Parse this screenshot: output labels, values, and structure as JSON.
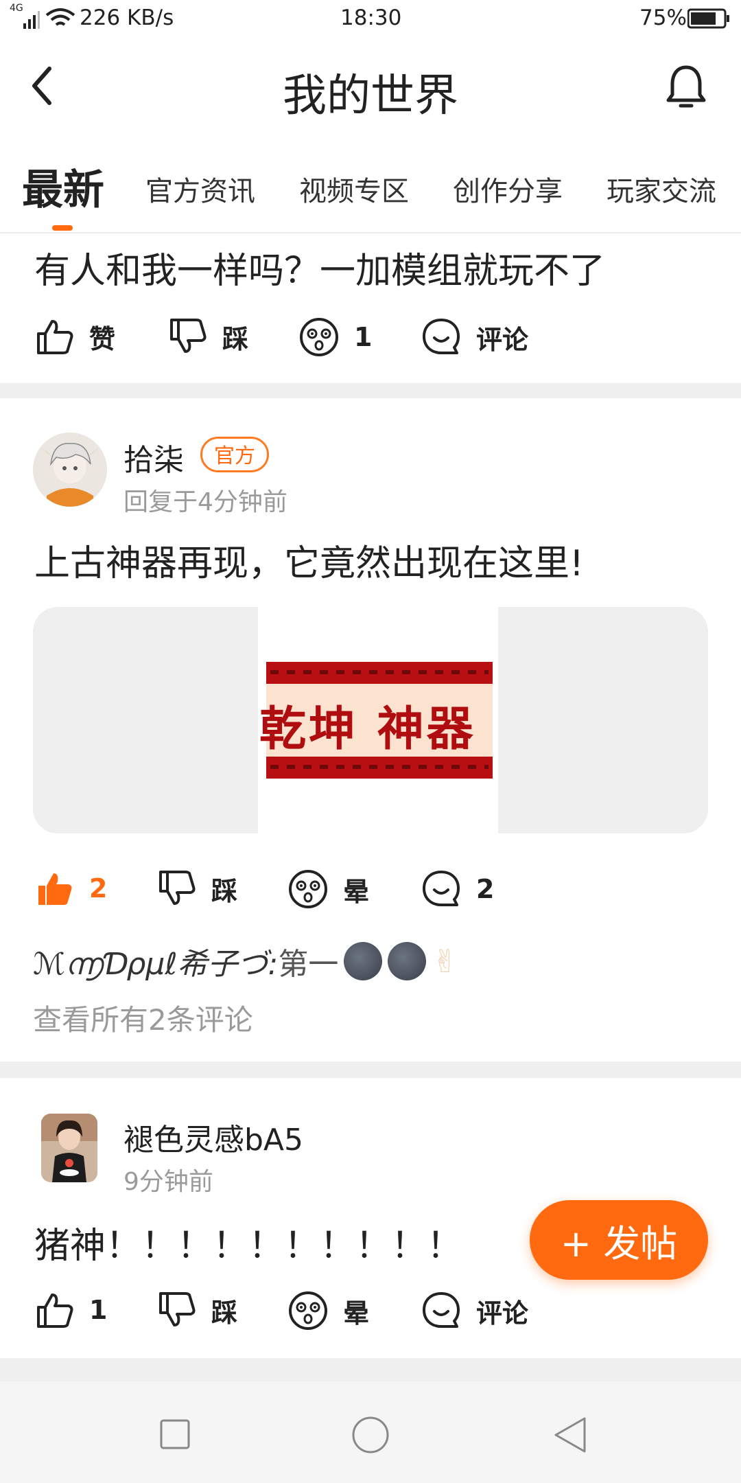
{
  "status_bar": {
    "network": "4G",
    "speed": "226 KB/s",
    "time": "18:30",
    "battery": "75%"
  },
  "header": {
    "title": "我的世界",
    "back_icon": "chevron-left-icon",
    "bell_icon": "bell-icon"
  },
  "tabs": [
    {
      "label": "最新",
      "active": true
    },
    {
      "label": "官方资讯"
    },
    {
      "label": "视频专区"
    },
    {
      "label": "创作分享"
    },
    {
      "label": "玩家交流"
    }
  ],
  "post1": {
    "title": "有人和我一样吗？一加模组就玩不了",
    "actions": {
      "like": "赞",
      "dislike": "踩",
      "dizzy": "1",
      "comment": "评论"
    }
  },
  "post2": {
    "author": "拾柒",
    "badge": "官方",
    "meta": "回复于4分钟前",
    "title": "上古神器再现，它竟然出现在这里!",
    "image_text": "乾坤 神器",
    "actions": {
      "like": "2",
      "dislike": "踩",
      "dizzy": "晕",
      "comment": "2"
    },
    "top_comment": {
      "user": "ℳ൬Ɗρμℓ希子づ:",
      "text": " 第一"
    },
    "view_all": "查看所有2条评论"
  },
  "post3": {
    "author": "褪色灵感bA5",
    "meta": "9分钟前",
    "title": "猪神！！！！！！！！！！",
    "actions": {
      "like": "1",
      "dislike": "踩",
      "dizzy": "晕",
      "comment": "评论"
    }
  },
  "fab": {
    "label": "+ 发帖"
  },
  "colors": {
    "accent": "#ff6a10"
  }
}
